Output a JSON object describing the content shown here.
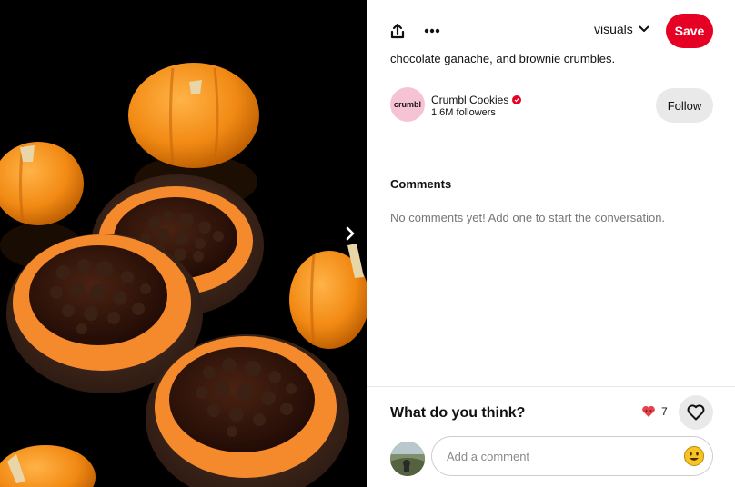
{
  "pin": {
    "description_visible": "chocolate ganache, and brownie crumbles.",
    "image_alt": "Pumpkin cookies with orange frosting, chocolate ganache and brownie crumbles on a black background"
  },
  "toolbar": {
    "board_name": "visuals",
    "save_label": "Save"
  },
  "creator": {
    "logo_text": "crumbl",
    "name": "Crumbl Cookies",
    "followers": "1.6M followers",
    "follow_label": "Follow"
  },
  "comments": {
    "heading": "Comments",
    "empty_text": "No comments yet! Add one to start the conversation."
  },
  "feedback": {
    "question": "What do you think?",
    "reaction_count": "7"
  },
  "composer": {
    "placeholder": "Add a comment"
  },
  "colors": {
    "brand_red": "#e60023",
    "button_gray": "#e9e9e9",
    "muted_text": "#767676"
  },
  "icons": {
    "share": "share-icon",
    "more": "more-icon",
    "chevron": "chevron-down-icon",
    "next": "chevron-right-icon",
    "heart_reaction": "heart-reaction-icon",
    "like": "heart-outline-icon",
    "emoji": "emoji-icon",
    "verified": "verified-badge-icon"
  }
}
